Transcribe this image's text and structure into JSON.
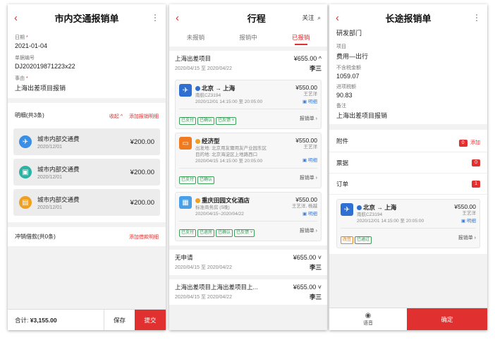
{
  "screen1": {
    "title": "市内交通报销单",
    "back_icon": "‹",
    "more_icon": "⋮",
    "fields": [
      {
        "label": "日期",
        "value": "2021-01-04",
        "required": "*"
      },
      {
        "label": "单据编号",
        "value": "DJ202019871223x22",
        "required": ""
      },
      {
        "label": "事由",
        "value": "上海出差项目报销",
        "required": "*"
      }
    ],
    "detail_title": "明细(共3条)",
    "collapse_label": "收起 ^",
    "add_detail_label": "添加报销明细",
    "items": [
      {
        "title": "城市内部交通费",
        "date": "2020/12/01",
        "amount": "¥200.00",
        "icon": "plane-icon",
        "color": "#3a8ee6",
        "glyph": "✈"
      },
      {
        "title": "城市内部交通费",
        "date": "2020/12/01",
        "amount": "¥200.00",
        "icon": "bus-icon",
        "color": "#2bb3a3",
        "glyph": "▣"
      },
      {
        "title": "城市内部交通费",
        "date": "2020/12/01",
        "amount": "¥200.00",
        "icon": "hotel-icon",
        "color": "#f0a020",
        "glyph": "▤"
      }
    ],
    "loan_title": "冲销借款(共0条)",
    "add_loan_label": "添加借款明细",
    "total_label": "合计: ",
    "total_value": "¥3,155.00",
    "save_label": "保存",
    "submit_label": "提交"
  },
  "screen2": {
    "title": "行程",
    "follow_label": "关注",
    "tabs": [
      "未报销",
      "报销中",
      "已报销"
    ],
    "trip1": {
      "name": "上海出差项目",
      "amount": "¥655.00 ^",
      "dates": "2020/04/15 至 2020/04/22",
      "person": "李三"
    },
    "entries": [
      {
        "icon": "flight-icon",
        "color": "#2e6fd1",
        "glyph": "✈",
        "name": "北京 → 上海",
        "sub1": "南航CZ3194",
        "sub2": "2020/12/01 14:15:00 至 20:05:00",
        "amount": "¥550.00",
        "person": "王艺洋",
        "detail": "▣ 明细",
        "tags": [
          "已支付",
          "已确认",
          "已反馈 ˅"
        ],
        "link": "报销单 ›"
      },
      {
        "icon": "car-icon",
        "color": "#f07a20",
        "glyph": "🚗",
        "name": "经济型",
        "sub1": "出发地: 北京用友爾用友产业园东区",
        "sub2": "目的地: 北京海淀区上地路西口",
        "sub3": "2020/04/15 14:15:00 至 20:05:00",
        "amount": "¥550.00",
        "person": "王艺洋",
        "detail": "▣ 明细",
        "tags": [
          "已支付",
          "已确认"
        ],
        "link": "报销单 ›"
      },
      {
        "icon": "hotel-icon",
        "color": "#4aa0e6",
        "glyph": "▦",
        "name": "重庆田园文化酒店",
        "sub1": "标准商务房 (5晚)",
        "sub2": "2020/04/15~2020/04/22",
        "amount": "¥550.00",
        "person": "王艺洋, 杨越",
        "detail": "▣ 明细",
        "tags": [
          "已支付",
          "已退房",
          "已确认",
          "已反馈 ˅"
        ],
        "link": "报销单 ›"
      }
    ],
    "trip2": {
      "name": "无申请",
      "amount": "¥655.00 ˅",
      "dates": "2020/04/15 至 2020/04/22",
      "person": "李三"
    },
    "trip3": {
      "name": "上海出差项目上海出差项目上...",
      "amount": "¥655.00 ˅",
      "dates": "2020/04/15 至 2020/04/22",
      "person": "李三"
    }
  },
  "screen3": {
    "title": "长途报销单",
    "dept": "研发部门",
    "fields": [
      {
        "label": "项目",
        "value": "费用—出行"
      },
      {
        "label": "不含税金额",
        "value": "1059.07"
      },
      {
        "label": "进项税额",
        "value": "90.83"
      },
      {
        "label": "备注",
        "value": "上海出差项目报销"
      }
    ],
    "attach_label": "附件",
    "attach_count": "0",
    "add_label": "添加",
    "invoice_label": "票据",
    "invoice_count": "0",
    "order_label": "订单",
    "order_count": "1",
    "entry": {
      "name": "北京 → 上海",
      "sub1": "南航CZ3194",
      "sub2": "2020/12/01 14:15:00 至 20:05:00",
      "amount": "¥550.00",
      "person": "王艺洋",
      "detail": "▣ 明细",
      "tags": [
        "改签",
        "已通过"
      ],
      "link": "报销单 ›"
    },
    "voice_label": "语音",
    "confirm_label": "确定"
  }
}
